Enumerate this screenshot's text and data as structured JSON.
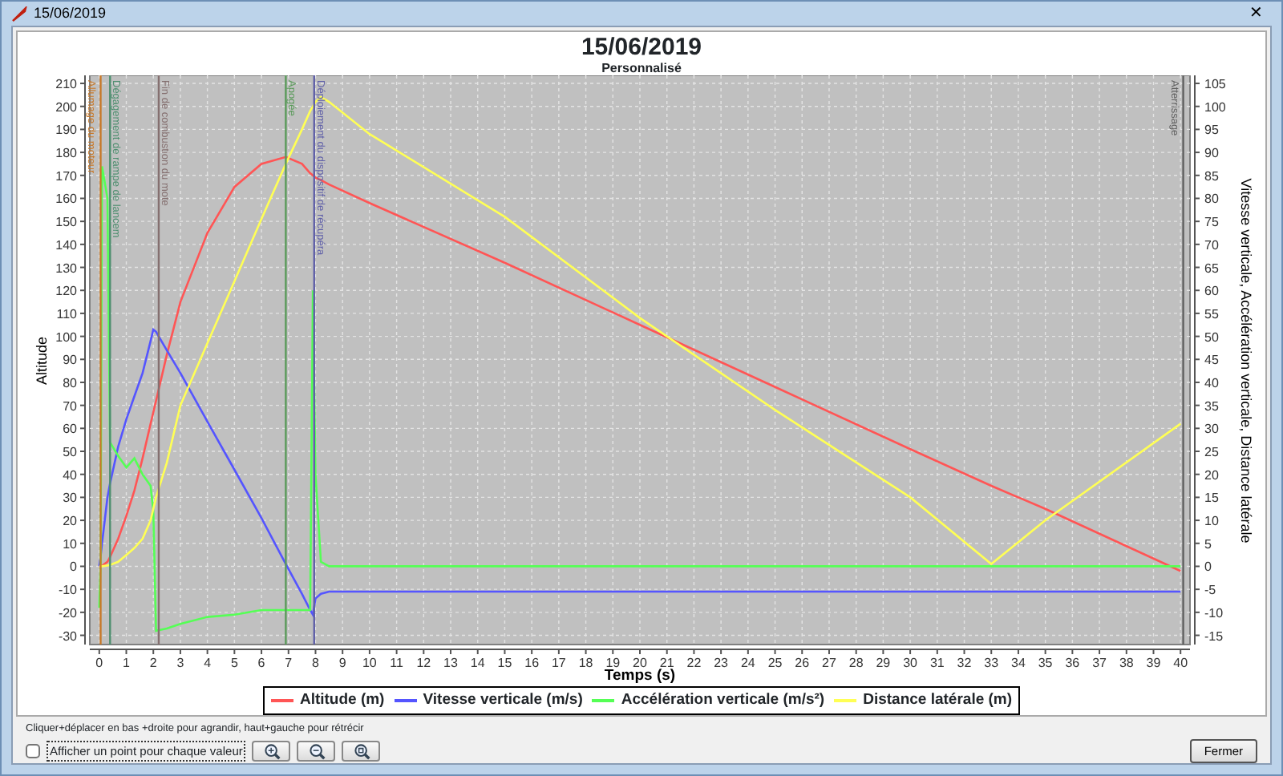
{
  "window": {
    "title": "15/06/2019",
    "close": "✕"
  },
  "chart": {
    "title": "15/06/2019",
    "subtitle": "Personnalisé",
    "chart_data": {
      "type": "line",
      "xlabel": "Temps (s)",
      "ylabel": "Altitude",
      "y2label": "Vitesse verticale, Accélération verticale, Distance latérale",
      "xlim": [
        -0.35,
        40.35
      ],
      "ylim": [
        -34,
        213.5
      ],
      "y2lim": [
        -17,
        106.75
      ],
      "xticks": [
        0,
        1,
        2,
        3,
        4,
        5,
        6,
        7,
        8,
        9,
        10,
        11,
        12,
        13,
        14,
        15,
        16,
        17,
        18,
        19,
        20,
        21,
        22,
        23,
        24,
        25,
        26,
        27,
        28,
        29,
        30,
        31,
        32,
        33,
        34,
        35,
        36,
        37,
        38,
        39,
        40
      ],
      "yticks": [
        -30,
        -20,
        -10,
        0,
        10,
        20,
        30,
        40,
        50,
        60,
        70,
        80,
        90,
        100,
        110,
        120,
        130,
        140,
        150,
        160,
        170,
        180,
        190,
        200,
        210
      ],
      "y2ticks": [
        -15,
        -10,
        -5,
        0,
        5,
        10,
        15,
        20,
        25,
        30,
        35,
        40,
        45,
        50,
        55,
        60,
        65,
        70,
        75,
        80,
        85,
        90,
        95,
        100,
        105
      ],
      "x": [
        0,
        0.05,
        0.1,
        0.3,
        0.4,
        0.7,
        1,
        1.3,
        1.6,
        1.9,
        2,
        2.1,
        2.5,
        3,
        4,
        5,
        6,
        6.9,
        7.5,
        7.8,
        7.9,
        8,
        8.2,
        8.5,
        10,
        15,
        20,
        25,
        30,
        33,
        35,
        40
      ],
      "series": [
        {
          "name": "Altitude (m)",
          "color": "#ff5555",
          "values": [
            0,
            0,
            0.2,
            2,
            4,
            12,
            22,
            33,
            47,
            62,
            67,
            72,
            92,
            115,
            145,
            165,
            175,
            178,
            175,
            171,
            170,
            169,
            168,
            166,
            158,
            132,
            105,
            78,
            51,
            35,
            25,
            -2
          ]
        },
        {
          "name": "Vitesse verticale (m/s)",
          "color": "#5555ff",
          "axis": "y2",
          "values": [
            0,
            2,
            5,
            15,
            18,
            26,
            32,
            37,
            42,
            49,
            51.5,
            51,
            47,
            42,
            31.5,
            21,
            10.5,
            0.5,
            -6,
            -9.5,
            -10.5,
            -7,
            -6,
            -5.5,
            -5.5,
            -5.5,
            -5.5,
            -5.5,
            -5.5,
            -5.5,
            -5.5,
            -5.5
          ]
        },
        {
          "name": "Accélération verticale (m/s²)",
          "color": "#55ff55",
          "axis": "y2",
          "values": [
            -9,
            0,
            87,
            80,
            27,
            24,
            21.5,
            23.5,
            20,
            17.5,
            12,
            -14,
            -13.5,
            -12.5,
            -11,
            -10.5,
            -9.5,
            -9.5,
            -9.5,
            -9.5,
            60,
            20,
            1,
            0,
            0,
            0,
            0,
            0,
            0,
            0,
            0,
            0
          ]
        },
        {
          "name": "Distance latérale (m)",
          "color": "#ffff55",
          "axis": "y2",
          "values": [
            0,
            0,
            0,
            0.2,
            0.3,
            1,
            2.5,
            4,
            6,
            10,
            12.5,
            15,
            22.5,
            35,
            48.5,
            62,
            75.5,
            87.5,
            95,
            99,
            100,
            101,
            102,
            101,
            94,
            76,
            54,
            34,
            15,
            0.5,
            10,
            31
          ]
        }
      ],
      "grid": true,
      "legend": "bottom",
      "ref_lines": [
        {
          "axis": "x",
          "value": 0.05,
          "label": "Allumage du moteur",
          "color": "#c87828"
        },
        {
          "axis": "x",
          "value": 0.4,
          "label": "Dégagement de rampe de lancem",
          "color": "#4f8f70"
        },
        {
          "axis": "x",
          "value": 2.2,
          "label": "Fin de combustion du mote",
          "color": "#857070"
        },
        {
          "axis": "x",
          "value": 6.9,
          "label": "Apogée",
          "color": "#5a9a5a"
        },
        {
          "axis": "x",
          "value": 7.95,
          "label": "Déploiement du dispositif de récupéra",
          "color": "#6060a8"
        },
        {
          "axis": "x",
          "value": 40.1,
          "label": "Atterrissage",
          "color": "#606060"
        }
      ]
    }
  },
  "footer": {
    "hint": "Cliquer+déplacer en bas +droite pour agrandir, haut+gauche pour rétrécir",
    "checkbox": {
      "label": "Afficher un point pour chaque valeur",
      "checked": false
    },
    "zoom_buttons": [
      {
        "kind": "zoom_in"
      },
      {
        "kind": "zoom_out"
      },
      {
        "kind": "zoom_fit"
      }
    ],
    "close_button": "Fermer"
  }
}
